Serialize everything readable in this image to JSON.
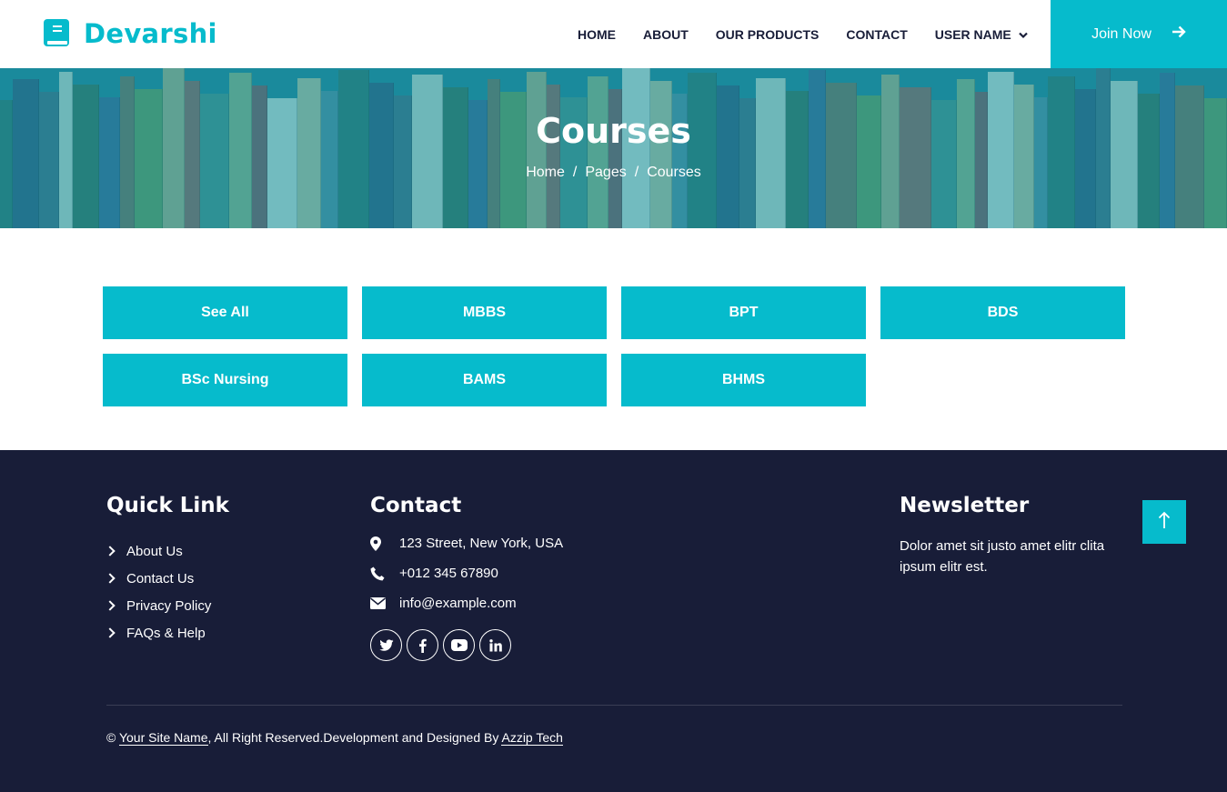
{
  "brand": {
    "name": "Devarshi",
    "icon": "book-icon",
    "color": "#06BBCC"
  },
  "nav": {
    "items": [
      "HOME",
      "ABOUT",
      "OUR PRODUCTS",
      "CONTACT"
    ],
    "user_label": "USER NAME",
    "join_label": "Join Now"
  },
  "hero": {
    "title": "Courses",
    "breadcrumb": [
      "Home",
      "Pages",
      "Courses"
    ]
  },
  "courses": [
    "See All",
    "MBBS",
    "BPT",
    "BDS",
    "BSc Nursing",
    "BAMS",
    "BHMS"
  ],
  "footer": {
    "quick_link": {
      "heading": "Quick Link",
      "items": [
        "About Us",
        "Contact Us",
        "Privacy Policy",
        "FAQs & Help"
      ]
    },
    "contact": {
      "heading": "Contact",
      "address": "123 Street, New York, USA",
      "phone": "+012 345 67890",
      "email": "info@example.com"
    },
    "socials": [
      "twitter-icon",
      "facebook-icon",
      "youtube-icon",
      "linkedin-icon"
    ],
    "newsletter": {
      "heading": "Newsletter",
      "text": "Dolor amet sit justo amet elitr clita ipsum elitr est."
    },
    "copyright": {
      "symbol": "©",
      "site_name": "Your Site Name",
      "middle": ", All Right Reserved.Development and Designed By ",
      "designer": "Azzip Tech"
    }
  },
  "colors": {
    "accent": "#06BBCC",
    "footer_bg": "#181d38"
  }
}
